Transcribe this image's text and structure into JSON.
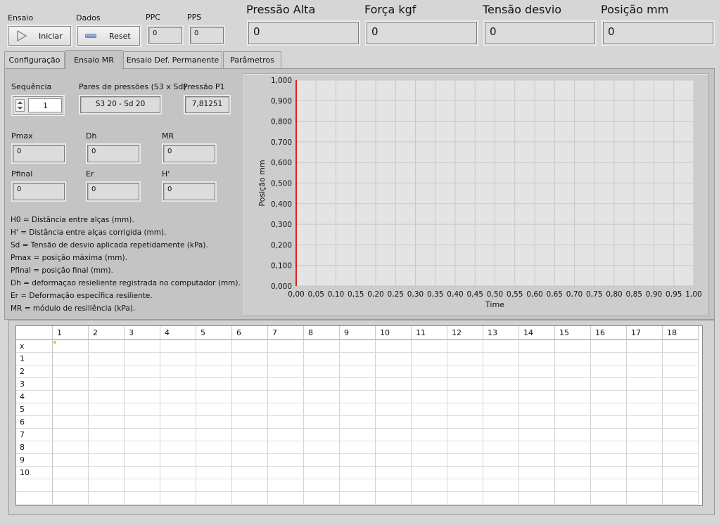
{
  "top": {
    "ensaio_label": "Ensaio",
    "dados_label": "Dados",
    "iniciar_label": "Iniciar",
    "reset_label": "Reset",
    "ppc_label": "PPC",
    "ppc_value": "0",
    "pps_label": "PPS",
    "pps_value": "0"
  },
  "readouts": [
    {
      "label": "Pressão Alta",
      "value": "0"
    },
    {
      "label": "Força kgf",
      "value": "0"
    },
    {
      "label": "Tensão desvio",
      "value": "0"
    },
    {
      "label": "Posição mm",
      "value": "0"
    }
  ],
  "tabs": [
    "Configuração",
    "Ensaio MR",
    "Ensaio Def. Permanente",
    "Parâmetros"
  ],
  "active_tab": "Ensaio MR",
  "controls": {
    "sequencia_label": "Sequência",
    "sequencia_value": "1",
    "pares_label": "Pares de pressões (S3 x Sd)",
    "pares_value": "S3 20 - Sd 20",
    "pressao_p1_label": "Pressão P1",
    "pressao_p1_value": "7,81251",
    "pmax_label": "Pmax",
    "pmax_value": "0",
    "dh_label": "Dh",
    "dh_value": "0",
    "mr_label": "MR",
    "mr_value": "0",
    "pfinal_label": "Pfinal",
    "pfinal_value": "0",
    "er_label": "Er",
    "er_value": "0",
    "hprime_label": "H'",
    "hprime_value": "0"
  },
  "descriptions": [
    "H0 = Distância entre alças (mm).",
    "H' = Distância entre alças corrigida (mm).",
    "Sd = Tensão de desvio aplicada repetidamente (kPa).",
    "Pmax = posição máxima (mm).",
    "Pfinal = posição final (mm).",
    "Dh = deformaçao resieliente registrada no computador (mm).",
    "Er = Deformação específica resiliente.",
    "MR = módulo de resiliência (kPa)."
  ],
  "chart_data": {
    "type": "line",
    "xlabel": "Time",
    "ylabel": "Posição mm",
    "xlim": [
      0,
      1
    ],
    "ylim": [
      0,
      1
    ],
    "x_ticks": [
      "0,00",
      "0,05",
      "0,10",
      "0,15",
      "0,20",
      "0,25",
      "0,30",
      "0,35",
      "0,40",
      "0,45",
      "0,50",
      "0,55",
      "0,60",
      "0,65",
      "0,70",
      "0,75",
      "0,80",
      "0,85",
      "0,90",
      "0,95",
      "1,00"
    ],
    "y_ticks": [
      "0,000",
      "0,100",
      "0,200",
      "0,300",
      "0,400",
      "0,500",
      "0,600",
      "0,700",
      "0,800",
      "0,900",
      "1,000"
    ],
    "grid": true,
    "series": [],
    "cursor_color": "#e02020"
  },
  "table": {
    "column_headers": [
      "1",
      "2",
      "3",
      "4",
      "5",
      "6",
      "7",
      "8",
      "9",
      "10",
      "11",
      "12",
      "13",
      "14",
      "15",
      "16",
      "17",
      "18"
    ],
    "row_headers": [
      "x",
      "1",
      "2",
      "3",
      "4",
      "5",
      "6",
      "7",
      "8",
      "9",
      "10"
    ],
    "empty_rows": 2
  }
}
